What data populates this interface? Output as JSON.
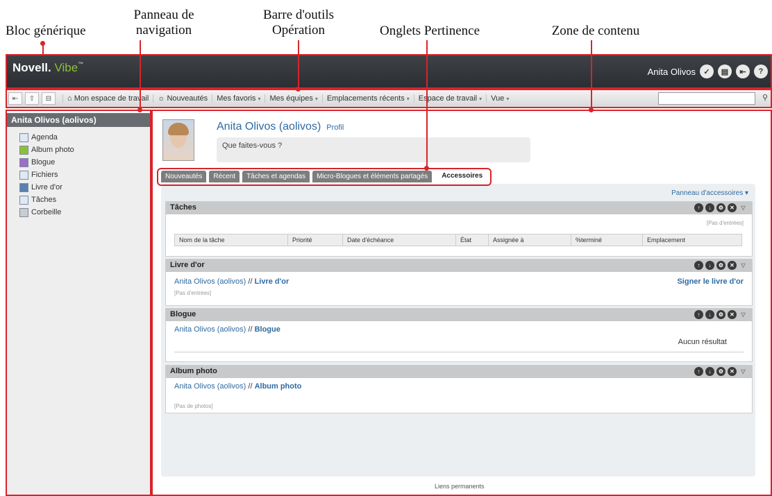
{
  "callouts": {
    "generic_block": "Bloc générique",
    "navigation_panel": "Panneau de navigation",
    "toolbar": "Barre d'outils Opération",
    "tabs": "Onglets Pertinence",
    "content_area": "Zone de contenu"
  },
  "header": {
    "logo_novell": "Novell.",
    "logo_vibe": "Vibe",
    "logo_tm": "™",
    "user_name": "Anita Olivos"
  },
  "toolbar": {
    "items": [
      "Mon espace de travail",
      "Nouveautés",
      "Mes favoris",
      "Mes équipes",
      "Emplacements récents",
      "Espace de travail",
      "Vue"
    ]
  },
  "sidebar": {
    "title": "Anita Olivos (aolivos)",
    "items": [
      "Agenda",
      "Album photo",
      "Blogue",
      "Fichiers",
      "Livre d'or",
      "Tâches",
      "Corbeille"
    ]
  },
  "profile": {
    "name": "Anita Olivos (aolivos)",
    "profile_link": "Profil",
    "status_placeholder": "Que faites-vous ?"
  },
  "tabs": [
    "Nouveautés",
    "Récent",
    "Tâches et agendas",
    "Micro-Blogues et éléments partagés",
    "Accessoires"
  ],
  "panel": {
    "menu_label": "Panneau d'accessoires ▾",
    "tasks": {
      "title": "Tâches",
      "empty": "[Pas d'entrées]",
      "columns": [
        "Nom de la tâche",
        "Priorité",
        "Date d'échéance",
        "État",
        "Assignée à",
        "%terminé",
        "Emplacement"
      ]
    },
    "guestbook": {
      "title": "Livre d'or",
      "owner": "Anita Olivos (aolivos)",
      "sep": " // ",
      "target": "Livre d'or",
      "sign": "Signer le livre d'or",
      "empty": "[Pas d'entrées]"
    },
    "blog": {
      "title": "Blogue",
      "owner": "Anita Olivos (aolivos)",
      "sep": " // ",
      "target": "Blogue",
      "no_result": "Aucun résultat"
    },
    "album": {
      "title": "Album photo",
      "owner": "Anita Olivos (aolivos)",
      "sep": " // ",
      "target": "Album photo",
      "empty": "[Pas de photos]"
    }
  },
  "footer": {
    "permalinks": "Liens permanents"
  },
  "accent_color": "#d9232a"
}
